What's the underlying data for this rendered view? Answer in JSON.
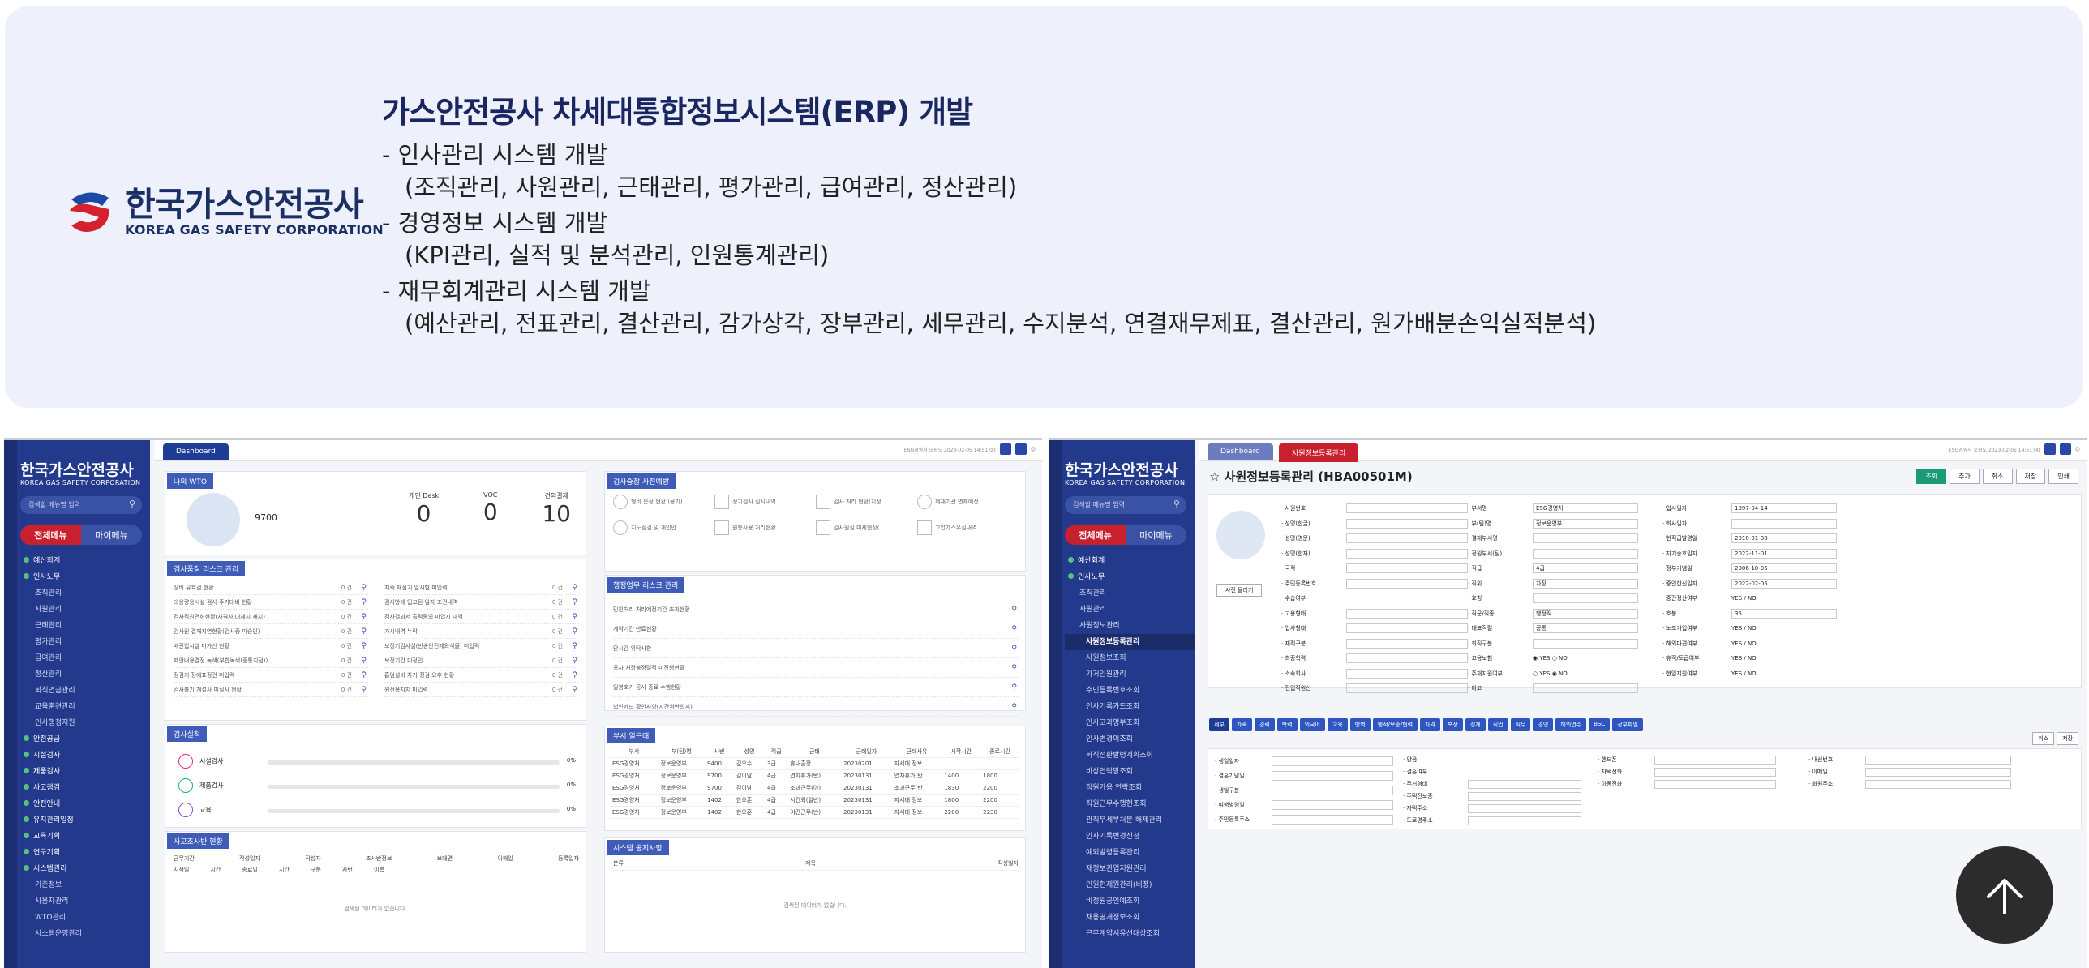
{
  "banner": {
    "logo_kr": "한국가스안전공사",
    "logo_en": "KOREA GAS SAFETY CORPORATION",
    "headline": "가스안전공사 차세대통합정보시스템(ERP) 개발",
    "bullets": [
      {
        "title": "- 인사관리 시스템 개발",
        "detail": "(조직관리, 사원관리, 근태관리, 평가관리, 급여관리, 정산관리)"
      },
      {
        "title": "- 경영정보 시스템 개발",
        "detail": "(KPI관리, 실적 및 분석관리, 인원통계관리)"
      },
      {
        "title": "- 재무회계관리 시스템 개발",
        "detail": "(예산관리, 전표관리, 결산관리, 감가상각, 장부관리, 세무관리, 수지분석, 연결재무제표, 결산관리, 원가배분손익실적분석)"
      }
    ]
  },
  "left_shot": {
    "nav": {
      "logo_kr": "한국가스안전공사",
      "logo_en": "KOREA GAS SAFETY CORPORATION",
      "search_placeholder": "검색할 메뉴명 입력",
      "tab_all": "전체메뉴",
      "tab_my": "마이메뉴",
      "items": [
        "예산회계",
        "인사노무",
        "조직관리",
        "사원관리",
        "근태관리",
        "평가관리",
        "급여관리",
        "정산관리",
        "퇴직연금관리",
        "교육훈련관리",
        "인사행정지원",
        "안전공급",
        "시설검사",
        "제품검사",
        "사고점검",
        "안전안내",
        "유지관리일정",
        "교육기획",
        "연구기획",
        "시스템관리",
        "기준정보",
        "사용자관리",
        "WTO관리",
        "시스템운영관리"
      ]
    },
    "tab": "Dashboard",
    "header_meta": "ESG경영처 오광도\n2023-02-05 14:51:00",
    "wto": {
      "title": "나의 WTO",
      "count": "9700",
      "labels": [
        "개인 Desk",
        "VOC",
        "건의결재"
      ],
      "values": [
        "0",
        "0",
        "10"
      ]
    },
    "risk": {
      "title": "검사품질 리스크 관리",
      "left": [
        "장비 유효검 현황",
        "대용량용시설 검사 주기대비 현황",
        "검사직원면허현황(자격사,대체시 재지)",
        "검사원 결재지연현황(검사중 미승인)",
        "배관업시설 미가산 현황",
        "제안내용결정 녹색(부합녹색(종통지점))",
        "정검기 장애표정건 미입력",
        "검사불기 개설사 미실시 현황"
      ],
      "right": [
        "지속 재점기 일시험 미입력",
        "검사방에 입고된 일자 조건내역",
        "검사결과서 출력종의 미입시 내역",
        "가시내역 누락",
        "보정기검사설(반송안전제외식물) 미입력",
        "보정기간 미정인",
        "흡엄설비 차기 정검 요후 현황",
        "원전용차지 미입력"
      ],
      "cnt": "0 건"
    },
    "perf": {
      "title": "검사실적",
      "items": [
        "시설검사",
        "제품검사",
        "교육"
      ],
      "pct": "0%"
    },
    "accident": {
      "title": "사고조사반 현황",
      "headers": [
        "근무기간",
        "작성일자",
        "작성자",
        "조사반정보",
        "보대면",
        "이해일",
        "등록일자"
      ],
      "subheaders": [
        "시작일",
        "시간",
        "종료일",
        "시간",
        "구분",
        "사번",
        "이름"
      ],
      "empty": "검색된 데이터가 없습니다."
    },
    "biz": {
      "title": "검사중장 사전예방",
      "items": [
        "형비 운정 현황 (용기)",
        "정기검사 실시내역...",
        "검사 처리 현황(지정...",
        "제재기관 면제예정",
        "지도점검 및 개인안",
        "원통사용 처리현황",
        "검사원실 미세현장(.",
        "고압가스우실내역"
      ]
    },
    "admin": {
      "title": "행정업무 리스크 관리",
      "items": [
        "민원처리 처리예정기간 초과현황",
        "계약기간 만료현황",
        "단시간 위탁사항",
        "공사 처장불정렬적 미진행현황",
        "일봉호가 공사 종료 수행현황",
        "법인카드 확인사항(시간위반의시)"
      ]
    },
    "attend": {
      "title": "부서 일근태",
      "headers": [
        "부서",
        "부(팀)명",
        "사번",
        "성명",
        "직급",
        "근태",
        "근태일자",
        "근태사유",
        "시작시간",
        "종료시간"
      ],
      "rows": [
        [
          "ESG경영처",
          "정보운영부",
          "9400",
          "김오수",
          "3급",
          "휴내출장",
          "20230201",
          "자세대 정보",
          "",
          ""
        ],
        [
          "ESG경영처",
          "정보운영부",
          "9700",
          "김이남",
          "4급",
          "연차휴가(반)",
          "20230131",
          "연차휴가(반",
          "1400",
          "1800"
        ],
        [
          "ESG경영처",
          "정보운영부",
          "9700",
          "김이남",
          "4급",
          "조과근무(야)",
          "20230131",
          "초과근무(반",
          "1830",
          "2200"
        ],
        [
          "ESG경영처",
          "정보운영부",
          "1402",
          "한으훈",
          "4급",
          "시간외(일반)",
          "20230131",
          "자세대 정보",
          "1800",
          "2200"
        ],
        [
          "ESG경영처",
          "정보운영부",
          "1402",
          "한으훈",
          "4급",
          "야간근무(반)",
          "20230131",
          "자세대 정보",
          "2200",
          "2230"
        ]
      ]
    },
    "notice": {
      "title": "시스템 공지사항",
      "headers": [
        "분류",
        "제목",
        "작성일자"
      ],
      "empty": "검색된 데이터가 없습니다."
    }
  },
  "right_shot": {
    "tabs": [
      "Dashboard",
      "사원정보등록관리"
    ],
    "title": "사원정보등록관리 (HBA00501M)",
    "buttons": [
      "조회",
      "추가",
      "취소",
      "저장",
      "인쇄"
    ],
    "photo_btn": "사진 올리기",
    "col1": [
      "사원번호",
      "성명(한글)",
      "성명(영문)",
      "성명(한자)",
      "국적",
      "주민등록번호",
      "수습여부",
      "고용형태",
      "입사형태",
      "재직구분",
      "최종학력",
      "소속회사",
      "전입직원산"
    ],
    "col2": [
      "부서명",
      "부(팀)명",
      "결재부서명",
      "정원부서(팀)",
      "직급",
      "직위",
      "호칭",
      "직군/직종",
      "대표직렬",
      "회직구분",
      "고용보험",
      "주재지원여부",
      "비고"
    ],
    "col2_vals": [
      "ESG경영처",
      "정보운영부",
      "",
      "",
      "4급",
      "차장",
      "",
      "행정직",
      "공통",
      "",
      "",
      "",
      ""
    ],
    "col3": [
      "입사일자",
      "회사일자",
      "현직급발령일",
      "자기승호일자",
      "정부기념일",
      "중인한신일자",
      "중간정산여부",
      "호봉",
      "노조가입여부",
      "해외파견여부",
      "휴직/도급여부",
      "현임지원여부"
    ],
    "col3_vals": [
      "1997-04-14",
      "",
      "2010-01-08",
      "2022-11-01",
      "2006-10-05",
      "2022-02-05",
      "YES / NO",
      "35",
      "YES / NO",
      "YES / NO",
      "YES / NO",
      "YES / NO"
    ],
    "subtabs": [
      "세부",
      "가족",
      "경력",
      "학력",
      "외국어",
      "교육",
      "병역",
      "행적/보증/협력",
      "자격",
      "포상",
      "징계",
      "직업",
      "직무",
      "경영",
      "해외연수",
      "BSC",
      "정부파일"
    ],
    "sub_btns": [
      "취소",
      "저장"
    ],
    "detail_l": [
      "생일일자",
      "결혼기념일",
      "생일구분",
      "여행별형일",
      "주민등록주소"
    ],
    "detail_m": [
      "양음",
      "결혼여부",
      "주거형태",
      "주택잔보증",
      "자택주소",
      "도로명주소"
    ],
    "detail_r": [
      "핸드폰",
      "자택전화",
      "이동전화",
      "이메일",
      "내선번호",
      "회원주소"
    ],
    "nav_items": [
      "예산회계",
      "인사노무",
      "조직관리",
      "사원관리",
      "사원정보관리",
      "사원정보등록관리",
      "사원정보조회",
      "가거인원관리",
      "주민등록번호조회",
      "인사기록카드조회",
      "인사고과명부조회",
      "인사변경이조회",
      "퇴직전환발령계획조회",
      "비상연락망조회",
      "직원가용 연락조회",
      "직원근무수행현조회",
      "관직무세부처분 해제관리",
      "인사기록변경신청",
      "예외발령등록관리",
      "재정보관업지원관리",
      "인원현재원관리(비정)",
      "비정원공인예조회",
      "채용공개정보조회",
      "근무계약서유선대상조회"
    ]
  },
  "colors": {
    "navy": "#233a8c",
    "red": "#c8202e",
    "banner": "#eef1fb",
    "green": "#53c37b"
  },
  "scroll_top_icon": "arrow-up-icon"
}
